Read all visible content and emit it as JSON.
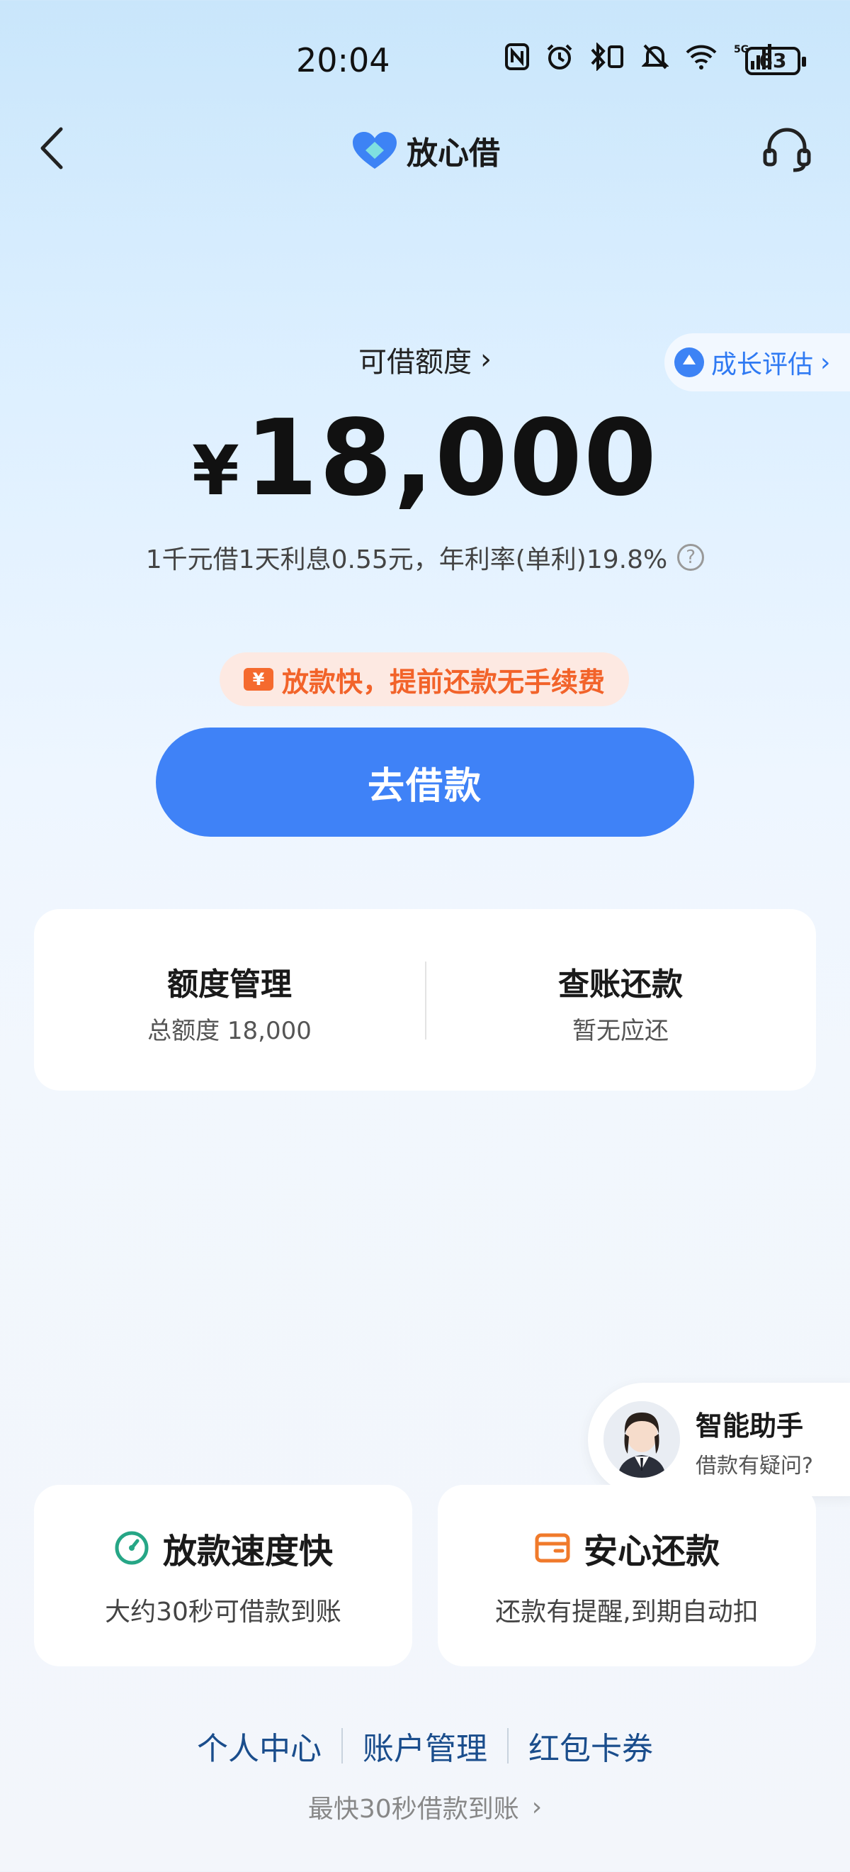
{
  "status_bar": {
    "time": "20:04",
    "battery": "63",
    "icons": [
      "nfc-icon",
      "alarm-icon",
      "bluetooth-icon",
      "vibrate-icon",
      "mute-icon",
      "wifi-icon",
      "5g-signal-icon"
    ]
  },
  "nav": {
    "title": "放心借"
  },
  "growth": {
    "label": "成长评估"
  },
  "limit": {
    "label": "可借额度",
    "currency": "¥",
    "amount": "18,000",
    "rate_text": "1千元借1天利息0.55元，年利率(单利)19.8%",
    "help": "?"
  },
  "promo": {
    "icon_text": "¥",
    "text": "放款快，提前还款无手续费"
  },
  "borrow_button": {
    "label": "去借款"
  },
  "manage": {
    "left_title": "额度管理",
    "left_sub": "总额度 18,000",
    "right_title": "查账还款",
    "right_sub": "暂无应还"
  },
  "assistant": {
    "title": "智能助手",
    "subtitle": "借款有疑问?"
  },
  "features": [
    {
      "title": "放款速度快",
      "subtitle": "大约30秒可借款到账"
    },
    {
      "title": "安心还款",
      "subtitle": "还款有提醒,到期自动扣"
    }
  ],
  "bottom_links": [
    "个人中心",
    "账户管理",
    "红包卡券"
  ],
  "bottom_note": "最快30秒借款到账",
  "colors": {
    "primary": "#3f82f7",
    "promo": "#f2632a",
    "link": "#1a4d8c"
  }
}
